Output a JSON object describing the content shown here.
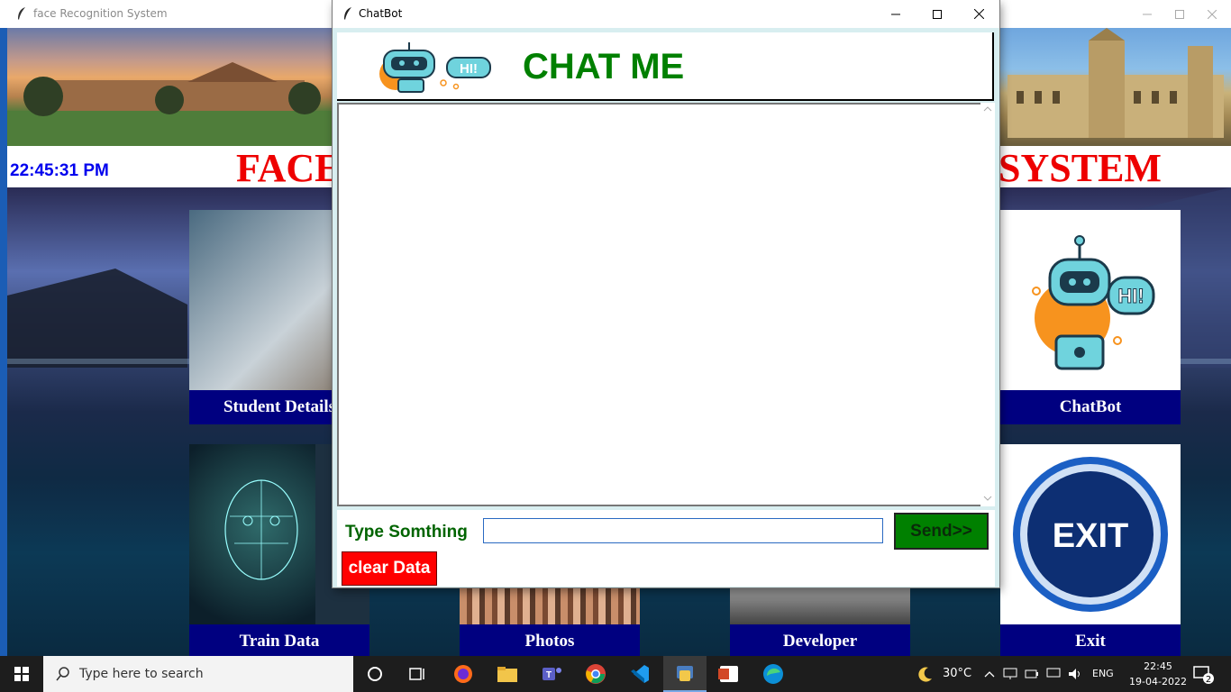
{
  "main_window": {
    "title": "face Recognition System",
    "clock": "22:45:31 PM",
    "app_title_left": "FACE",
    "app_title_right": "SYSTEM",
    "tiles": [
      {
        "label": "Student Details"
      },
      {
        "label": "ChatBot"
      },
      {
        "label": "Train Data"
      },
      {
        "label": "Photos"
      },
      {
        "label": "Developer"
      },
      {
        "label": "Exit"
      }
    ],
    "exit_text": "EXIT"
  },
  "chat_window": {
    "title": "ChatBot",
    "header": "CHAT ME",
    "hi_badge": "HI!",
    "type_label": "Type Somthing",
    "input_value": "",
    "send_label": "Send>>",
    "clear_label": "clear Data"
  },
  "taskbar": {
    "search_placeholder": "Type here to search",
    "temperature": "30°C",
    "language": "ENG",
    "time": "22:45",
    "date": "19-04-2022",
    "notification_count": "2",
    "apps": [
      "cortana-icon",
      "task-view-icon",
      "firefox-icon",
      "file-explorer-icon",
      "teams-icon",
      "chrome-icon",
      "vscode-icon",
      "python-icon",
      "powerpoint-icon",
      "edge-icon"
    ]
  },
  "colors": {
    "title_red": "#ee0000",
    "clock_blue": "#0000ee",
    "tile_label_bg": "#000080",
    "chat_header_green": "#008000",
    "send_bg": "#008000",
    "clear_bg": "#ff0000"
  }
}
